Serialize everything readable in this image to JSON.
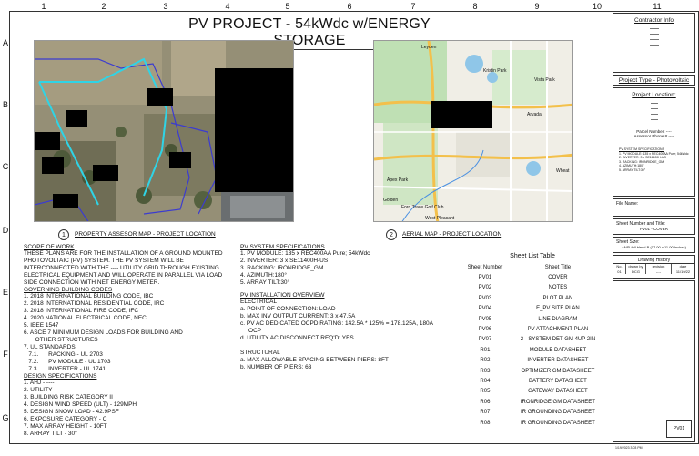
{
  "grid": {
    "columns": [
      "1",
      "2",
      "3",
      "4",
      "5",
      "6",
      "7",
      "8",
      "9",
      "10",
      "11"
    ],
    "rows": [
      "A",
      "B",
      "C",
      "D",
      "E",
      "F",
      "G"
    ]
  },
  "title": "PV PROJECT - 54kWdc w/ENERGY STORAGE",
  "maps": {
    "left": {
      "number": "1",
      "caption": "PROPERTY ASSESOR MAP - PROJECT LOCATION"
    },
    "right": {
      "number": "2",
      "caption": "AERIAL MAP - PROJECT LOCATION",
      "labels": [
        "Leyden",
        "Arvada",
        "Golden",
        "Wheat",
        "West Pleasant",
        "Apex Park",
        "Ford Trace Golf Club",
        "Kristin Park",
        "Vista Park"
      ]
    }
  },
  "scope": {
    "heading": "SCOPE OF WORK",
    "lines": [
      "THESE PLANS ARE FOR THE INSTALLATION OF A GROUND MOUNTED",
      "PHOTOVOLTAIC (PV) SYSTEM. THE PV SYSTEM WILL BE",
      "INTERCONNECTED WITH THE ---- UTILITY GRID THROUGH EXISTING",
      "ELECTRICAL EQUIPMENT AND WILL OPERATE IN PARALLEL VIA LOAD",
      "SIDE CONNECTION WITH NET ENERGY METER."
    ]
  },
  "codes": {
    "heading": "GOVERNING BUILDING CODES",
    "lines": [
      "1.    2018 INTERNATIONAL BUILDING CODE, IBC",
      "2.    2018 INTERNATIONAL RESIDENTIAL CODE, IRC",
      "3.    2018 INTERNATIONAL FIRE CODE, IFC",
      "4.    2020 NATIONAL ELECTRICAL CODE, NEC",
      "5.    IEEE 1547",
      "6.    ASCE 7 MINIMUM DESIGN LOADS FOR BUILDING AND",
      "       OTHER STRUCTURES",
      "7.    UL STANDARDS",
      "   7.1.      RACKING - UL 2703",
      "   7.2.      PV MODULE - UL 1703",
      "   7.3.      INVERTER - UL 1741"
    ]
  },
  "design": {
    "heading": "DESIGN SPECIFICATIONS",
    "lines": [
      "1.    AHJ - ----",
      "2.    UTILITY - ----",
      "3.    BUILDING RISK CATEGORY II",
      "4.    DESIGN WIND SPEED (ULT) -  129MPH",
      "5.    DESIGN SNOW LOAD -  42.9PSF",
      "6.    EXPOSURE CATEGORY - C",
      "7.    MAX ARRAY HEIGHT - 10FT",
      "8.    ARRAY TILT - 30°"
    ]
  },
  "pv_specs": {
    "heading": "PV SYSTEM SPECIFICATIONS",
    "lines": [
      "1.    PV MODULE: 135 x REC400AA Pure; 54kWdc",
      "2.    INVERTER: 3 x SE11400H-US",
      "3.    RACKING: IRONRIDGE_GM",
      "4.    AZIMUTH:180°",
      "5.    ARRAY TILT:30°"
    ]
  },
  "install": {
    "heading": "PV INSTALLATION OVERVIEW",
    "electrical_label": "ELECTRICAL",
    "electrical_lines": [
      "a.  POINT OF CONNECTION: LOAD",
      "b.  MAX INV OUTPUT CURRENT: 3 x 47.5A",
      "c.  PV AC DEDICATED OCPD RATING: 142.5A * 125% = 178.125A, 180A",
      "     OCP",
      "d.  UTILITY AC DISCONNECT REQ'D: YES"
    ],
    "structural_label": "STRUCTURAL",
    "structural_lines": [
      "a.  MAX ALLOWABLE SPACING BETWEEN PIERS: 8FT",
      "b.  NUMBER OF PIERS: 63"
    ]
  },
  "sheet_list": {
    "title": "Sheet List Table",
    "headers": [
      "Sheet Number",
      "Sheet Title"
    ],
    "rows": [
      [
        "PV01",
        "COVER"
      ],
      [
        "PV02",
        "NOTES"
      ],
      [
        "PV03",
        "PLOT PLAN"
      ],
      [
        "PV04",
        "E_PV SITE PLAN"
      ],
      [
        "PV05",
        "LINE DIAGRAM"
      ],
      [
        "PV06",
        "PV ATTACHMENT PLAN"
      ],
      [
        "PV07",
        "2 - SYSTEM DET GM 4UP 2IN"
      ],
      [
        "R01",
        "MODULE DATASHEET"
      ],
      [
        "R02",
        "INVERTER DATASHEET"
      ],
      [
        "R03",
        "OPTIMIZER GM DATASHEET"
      ],
      [
        "R04",
        "BATTERY DATASHEET"
      ],
      [
        "R05",
        "GATEWAY DATASHEET"
      ],
      [
        "R06",
        "IRONRIDGE GM DATASHEET"
      ],
      [
        "R07",
        "IR GROUNDING DATASHEET"
      ],
      [
        "R08",
        "IR GROUNDING DATASHEET"
      ]
    ]
  },
  "title_block": {
    "contractor_info": "Contractor Info",
    "project_type": "Project Type - Photovoltaic",
    "project_location": "Project Location:",
    "parcel_number": "Parcel Number: ----",
    "assessor_phone": "Assessor Phone # ----",
    "specs_heading": "PV SYSTEM SPECIFICATIONS",
    "specs_lines": [
      "1.  PV MODULE: 135 x REC400AA Pure; 54kWdc",
      "2.  INVERTER: 3 x SE11400H-US",
      "3.  RACKING: IRONRIDGE_GM",
      "4.  AZIMUTH:180°",
      "5.  ARRAY TILT:30°"
    ],
    "file_name_label": "File Name:",
    "sheet_number_title_label": "Sheet Number and Title:",
    "sheet_number_title_value": "PV01 - COVER",
    "sheet_size_label": "Sheet Size:",
    "sheet_size_value": "ANSI full bleed B (17.00 x 11.00 Inches)",
    "drawing_history": "Drawing History",
    "history_headers": [
      "No.",
      "drawn by",
      "revision",
      "date"
    ],
    "history_row": [
      "01",
      "DCG",
      "----",
      "11/19/22"
    ],
    "sheet_id": "PV01",
    "footer_date": "1/19/2023 3:03 PM"
  }
}
